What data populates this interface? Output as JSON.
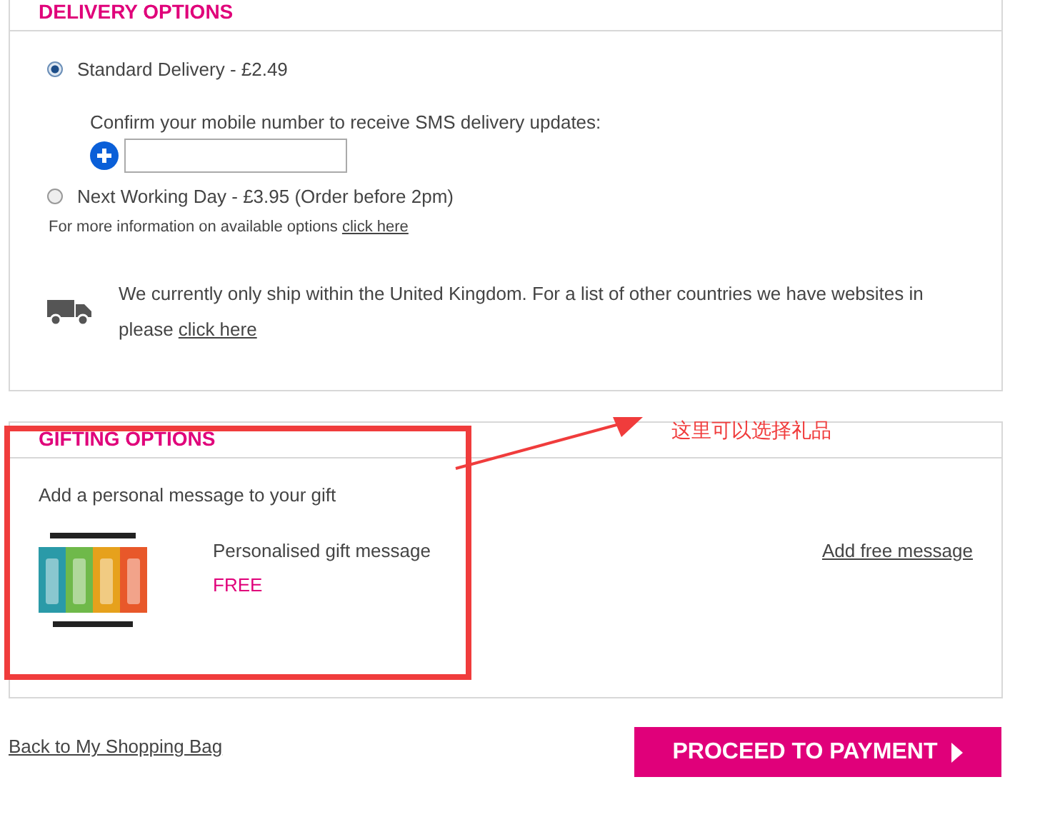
{
  "delivery": {
    "title": "DELIVERY OPTIONS",
    "options": [
      {
        "label": "Standard Delivery - £2.49",
        "selected": true,
        "sms_prompt": "Confirm your mobile number to receive SMS delivery updates:"
      },
      {
        "label": "Next Working Day - £3.95 (Order before 2pm)",
        "selected": false
      }
    ],
    "info": {
      "text": "For more information on available options ",
      "link": "click here"
    },
    "shipping_note": {
      "text": "We currently only ship within the United Kingdom. For a list of other countries we have websites in please ",
      "link": "click here"
    }
  },
  "gifting": {
    "title": "GIFTING OPTIONS",
    "intro": "Add a personal message to your gift",
    "item": {
      "name": "Personalised gift message",
      "price": "FREE",
      "action": "Add free message"
    }
  },
  "footer": {
    "back_link": "Back to My Shopping Bag",
    "proceed_button": "PROCEED TO PAYMENT"
  },
  "annotation": {
    "text": "这里可以选择礼品"
  }
}
